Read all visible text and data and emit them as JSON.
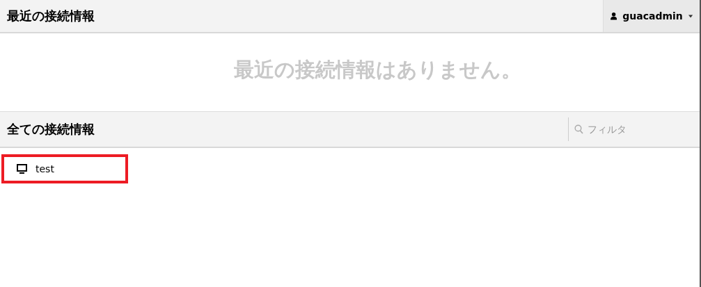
{
  "header": {
    "title": "最近の接続情報",
    "user_menu": {
      "username": "guacadmin"
    }
  },
  "recent": {
    "empty_message": "最近の接続情報はありません。"
  },
  "all_connections": {
    "title": "全ての接続情報",
    "filter": {
      "placeholder": "フィルタ"
    },
    "items": [
      {
        "name": "test",
        "highlighted": true
      }
    ]
  }
}
